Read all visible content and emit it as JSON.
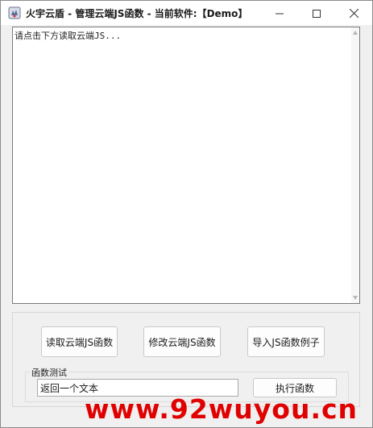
{
  "window": {
    "title": "火宇云盾 - 管理云端JS函数 - 当前软件:【Demo】",
    "icons": {
      "app": "shield-app-icon",
      "minimize": "minimize-icon",
      "maximize": "maximize-icon",
      "close": "close-icon"
    }
  },
  "output": {
    "text": "请点击下方读取云端JS..."
  },
  "actions": {
    "read_label": "读取云端JS函数",
    "modify_label": "修改云端JS函数",
    "import_label": "导入JS函数例子"
  },
  "test_group": {
    "title": "函数测试",
    "input_value": "返回一个文本",
    "exec_label": "执行函数"
  },
  "watermark": {
    "text": "www.92wuyou.cn",
    "color": "#e00000"
  }
}
